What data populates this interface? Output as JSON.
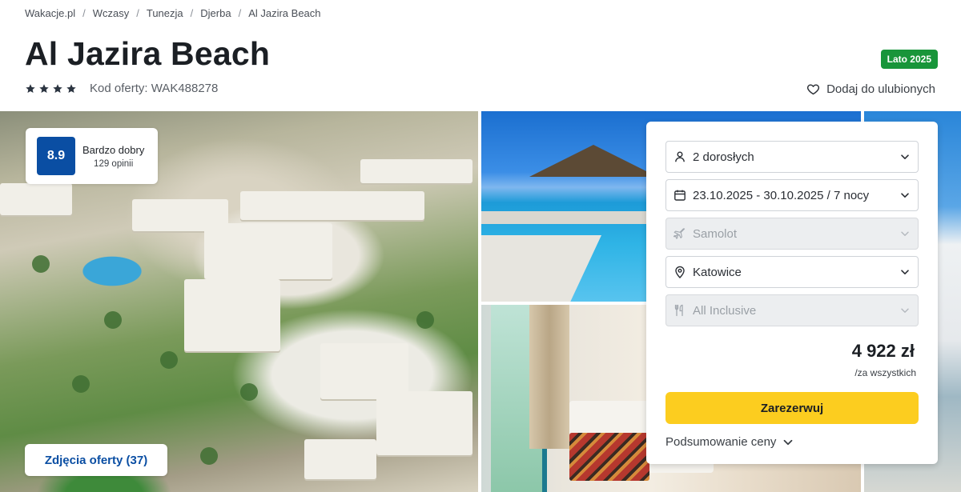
{
  "breadcrumb": [
    "Wakacje.pl",
    "Wczasy",
    "Tunezja",
    "Djerba",
    "Al Jazira Beach"
  ],
  "hotel": {
    "title": "Al Jazira Beach",
    "stars": 4,
    "offer_code": "Kod oferty: WAK488278",
    "season_badge": "Lato 2025",
    "favorite_label": "Dodaj do ulubionych"
  },
  "rating": {
    "score": "8.9",
    "label": "Bardzo dobry",
    "count": "129 opinii"
  },
  "gallery": {
    "photos_button": "Zdjęcia oferty (37)"
  },
  "booking": {
    "travelers": "2 dorosłych",
    "dates": "23.10.2025 - 30.10.2025 / 7 nocy",
    "transport": "Samolot",
    "departure": "Katowice",
    "board": "All Inclusive",
    "price": "4 922 zł",
    "price_note": "/za wszystkich",
    "book_label": "Zarezerwuj",
    "summary_label": "Podsumowanie ceny"
  },
  "colors": {
    "brand_blue": "#0a4ea3",
    "season_green": "#18953a",
    "book_yellow": "#fccd1f"
  }
}
